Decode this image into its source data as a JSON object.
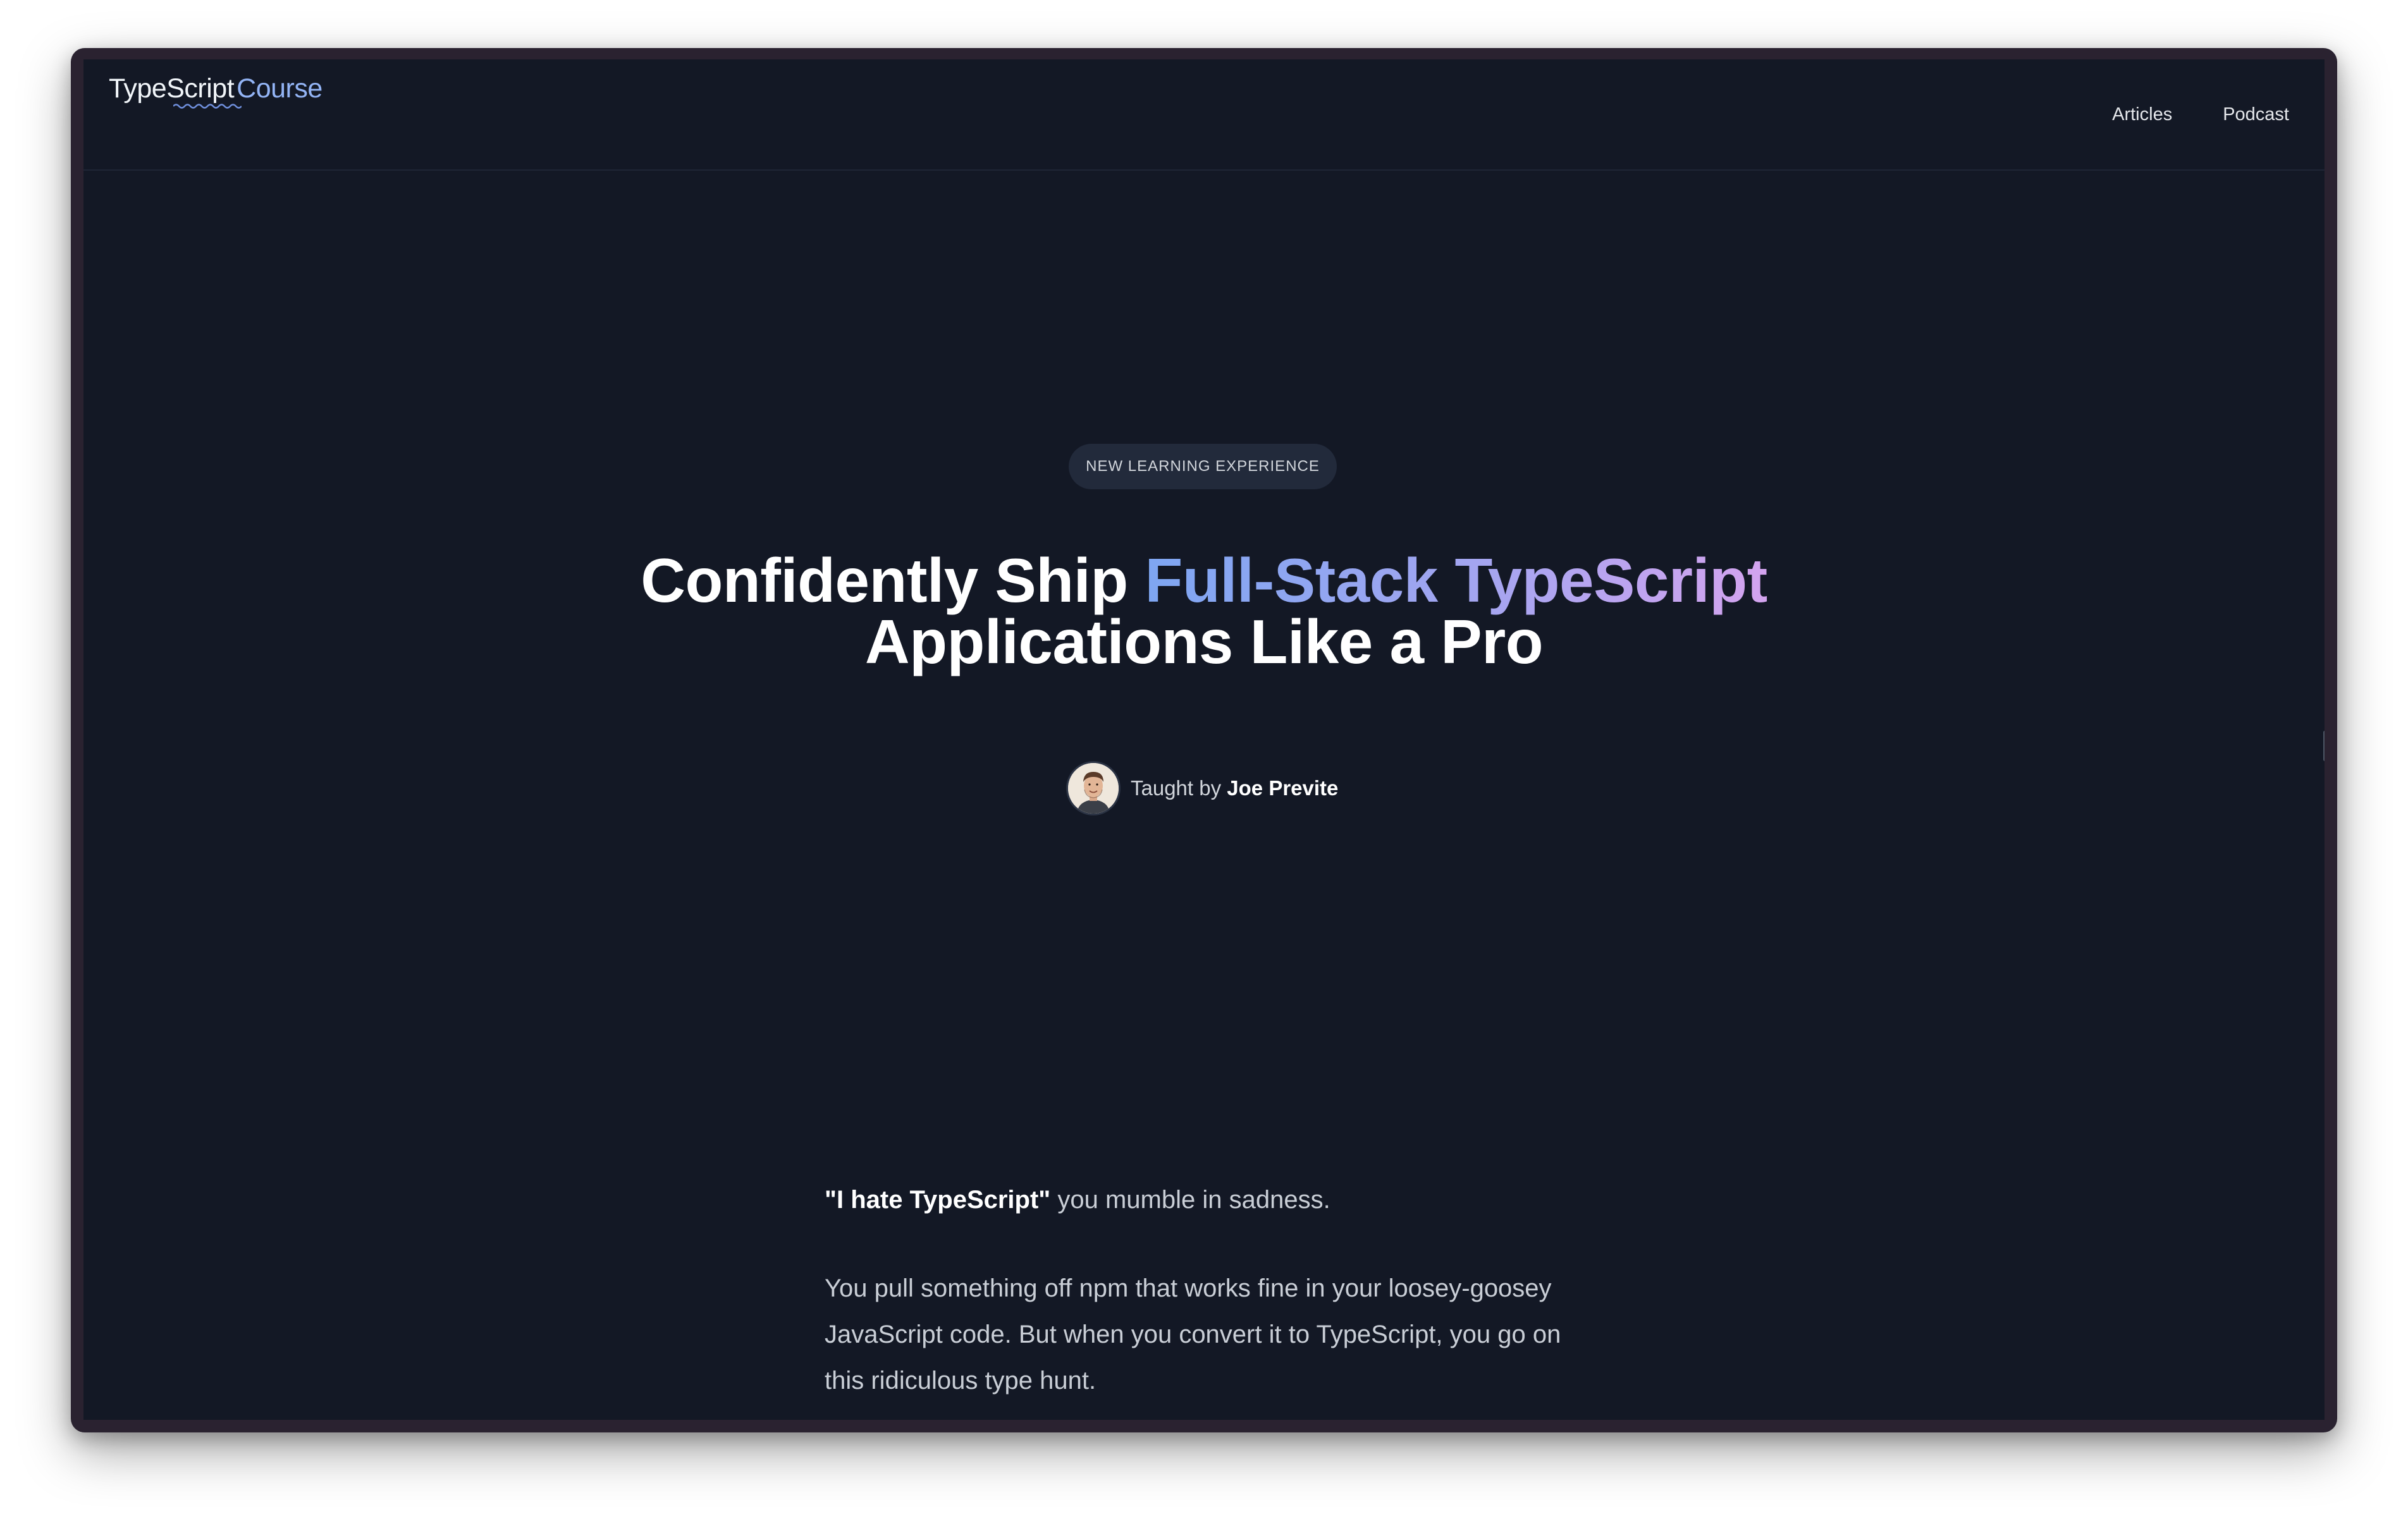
{
  "header": {
    "logo_main": "TypeScript",
    "logo_accent": "Course",
    "nav": [
      {
        "label": "Articles"
      },
      {
        "label": "Podcast"
      }
    ]
  },
  "hero": {
    "badge": "NEW LEARNING EXPERIENCE",
    "title_part1": "Confidently Ship ",
    "title_highlight": "Full-Stack TypeScript",
    "title_part2": "Applications Like a Pro",
    "taught_by_prefix": "Taught by",
    "instructor": "Joe Previte"
  },
  "content": {
    "quote": "\"I hate TypeScript\"",
    "quote_suffix": " you mumble in sadness.",
    "paragraph": "You pull something off npm that works fine in your loosey-goosey JavaScript code. But when you convert it to TypeScript, you go on this ridiculous type hunt."
  },
  "colors": {
    "background": "#131825",
    "gradient_start": "#7ea6f2",
    "gradient_end": "#d4a4ef",
    "logo_accent": "#93b4f5"
  }
}
